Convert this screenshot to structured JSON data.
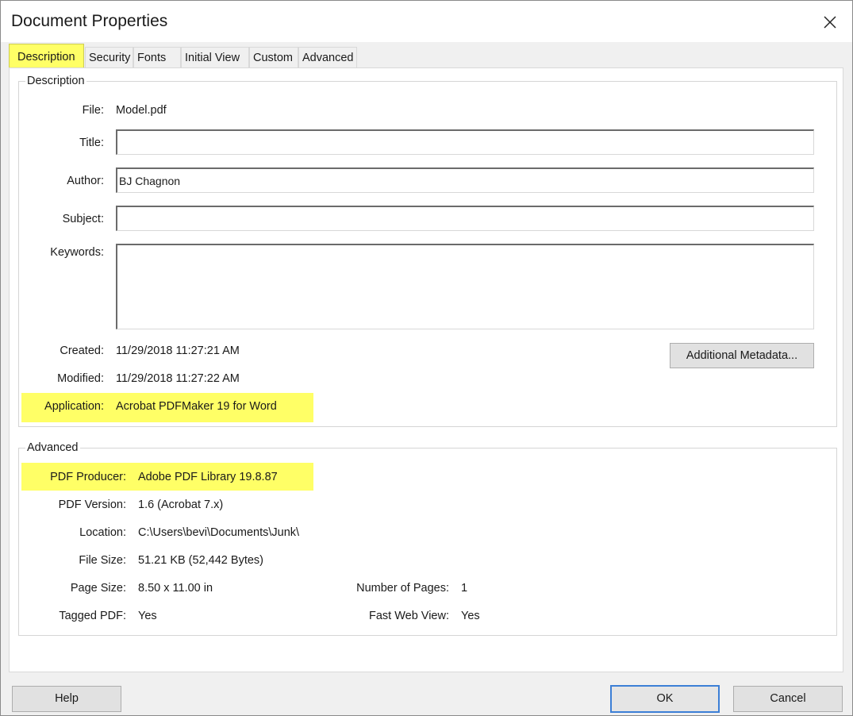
{
  "window": {
    "title": "Document Properties"
  },
  "tabs": [
    {
      "label": "Description"
    },
    {
      "label": "Security"
    },
    {
      "label": "Fonts"
    },
    {
      "label": "Initial View"
    },
    {
      "label": "Custom"
    },
    {
      "label": "Advanced"
    }
  ],
  "description": {
    "group_label": "Description",
    "file_label": "File:",
    "file_value": "Model.pdf",
    "title_label": "Title:",
    "title_value": "",
    "author_label": "Author:",
    "author_value": "BJ Chagnon",
    "subject_label": "Subject:",
    "subject_value": "",
    "keywords_label": "Keywords:",
    "keywords_value": "",
    "created_label": "Created:",
    "created_value": "11/29/2018 11:27:21 AM",
    "modified_label": "Modified:",
    "modified_value": "11/29/2018 11:27:22 AM",
    "application_label": "Application:",
    "application_value": "Acrobat PDFMaker 19 for Word",
    "metadata_button": "Additional Metadata..."
  },
  "advanced": {
    "group_label": "Advanced",
    "producer_label": "PDF Producer:",
    "producer_value": "Adobe PDF Library 19.8.87",
    "version_label": "PDF Version:",
    "version_value": "1.6 (Acrobat 7.x)",
    "location_label": "Location:",
    "location_value": "C:\\Users\\bevi\\Documents\\Junk\\",
    "filesize_label": "File Size:",
    "filesize_value": "51.21 KB (52,442 Bytes)",
    "pagesize_label": "Page Size:",
    "pagesize_value": "8.50 x 11.00 in",
    "numpages_label": "Number of Pages:",
    "numpages_value": "1",
    "tagged_label": "Tagged PDF:",
    "tagged_value": "Yes",
    "fastweb_label": "Fast Web View:",
    "fastweb_value": "Yes"
  },
  "footer": {
    "help_button": "Help",
    "ok_button": "OK",
    "cancel_button": "Cancel"
  },
  "colors": {
    "highlight": "#ffff66",
    "default_button_border": "#3c7fd6"
  },
  "icons": {
    "close": "close-icon"
  }
}
